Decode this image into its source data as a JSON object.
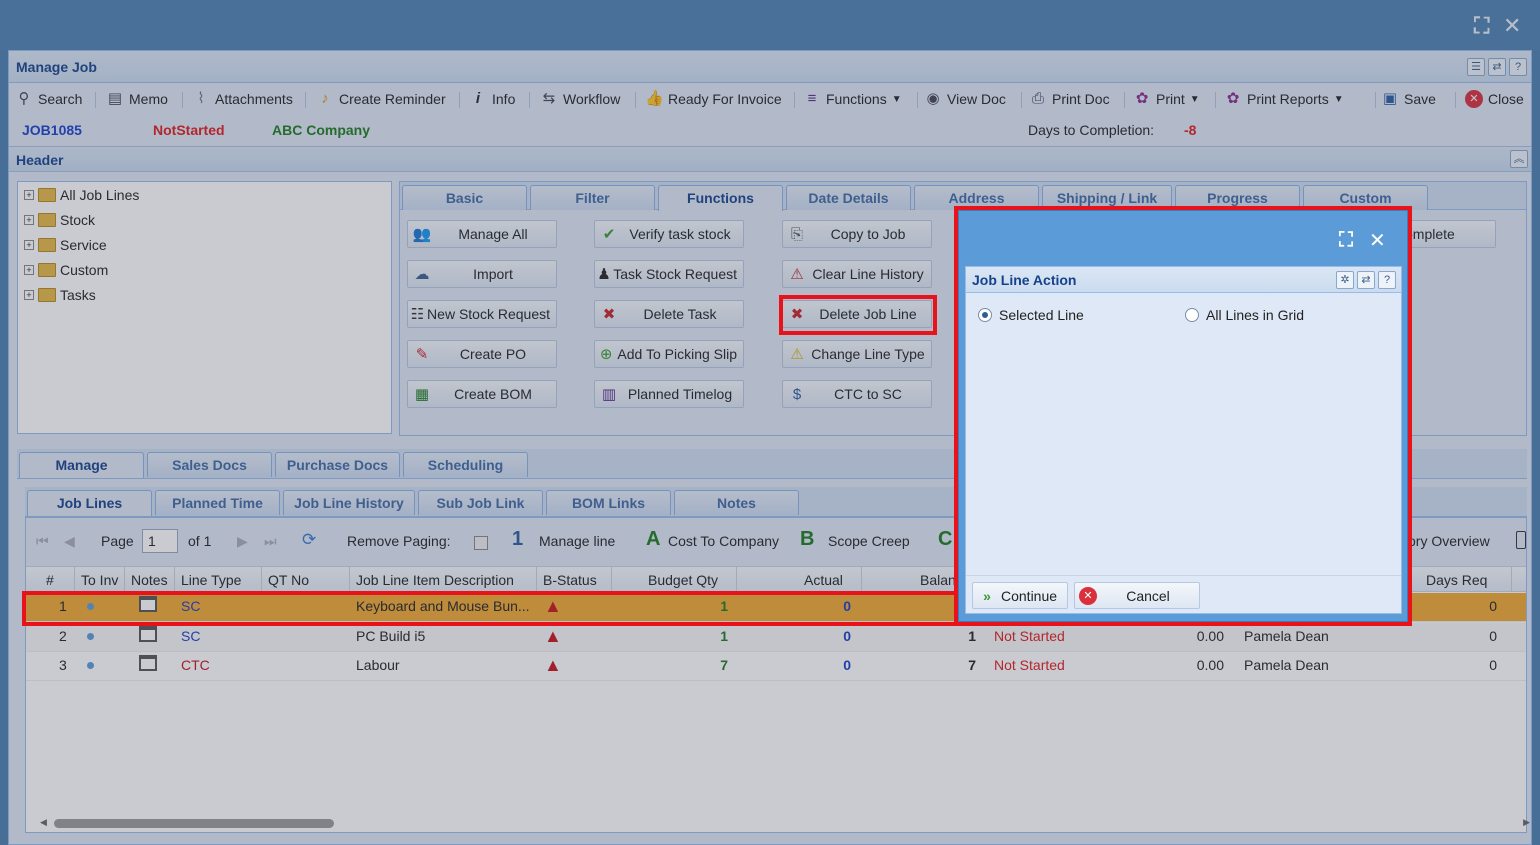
{
  "window": {
    "title": "Manage Job",
    "header_section": "Header",
    "ctrl_maximize": "⛶",
    "ctrl_close": "✕"
  },
  "toolbar": {
    "search": "Search",
    "memo": "Memo",
    "attachments": "Attachments",
    "create_reminder": "Create Reminder",
    "info": "Info",
    "workflow": "Workflow",
    "ready_for_invoice": "Ready For Invoice",
    "functions": "Functions",
    "view_doc": "View Doc",
    "print_doc": "Print Doc",
    "print": "Print",
    "print_reports": "Print Reports",
    "save": "Save",
    "close": "Close"
  },
  "job": {
    "number": "JOB1085",
    "status": "NotStarted",
    "company": "ABC Company",
    "days_label": "Days to Completion:",
    "days_value": "-8"
  },
  "tree": {
    "items": [
      "All Job Lines",
      "Stock",
      "Service",
      "Custom",
      "Tasks"
    ]
  },
  "function_tabs": [
    "Basic",
    "Filter",
    "Functions",
    "Date Details",
    "Address",
    "Shipping / Link",
    "Progress",
    "Custom"
  ],
  "function_buttons": {
    "manage_all": "Manage All",
    "import": "Import",
    "new_stock_request": "New Stock Request",
    "create_po": "Create PO",
    "create_bom": "Create BOM",
    "verify_task_stock": "Verify task stock",
    "task_stock_request": "Task Stock Request",
    "delete_task": "Delete Task",
    "add_to_picking_slip": "Add To Picking Slip",
    "planned_timelog": "Planned Timelog",
    "copy_to_job": "Copy to Job",
    "clear_line_history": "Clear Line History",
    "delete_job_line": "Delete Job Line",
    "change_line_type": "Change Line Type",
    "ctc_to_sc": "CTC to SC",
    "complete_partial": "omplete"
  },
  "bottom_tabs": [
    "Manage",
    "Sales Docs",
    "Purchase Docs",
    "Scheduling"
  ],
  "sub_tabs": [
    "Job Lines",
    "Planned Time",
    "Job Line History",
    "Sub Job Link",
    "BOM Links",
    "Notes"
  ],
  "pager": {
    "page_label": "Page",
    "page_value": "1",
    "of_label": "of 1",
    "remove_paging": "Remove Paging:",
    "legend_1_key": "1",
    "legend_1": "Manage line",
    "legend_a_key": "A",
    "legend_a": "Cost To Company",
    "legend_b_key": "B",
    "legend_b": "Scope Creep",
    "legend_c_key": "C",
    "history_overview": "ory Overview"
  },
  "grid": {
    "columns": [
      "#",
      "To Inv",
      "Notes",
      "Line Type",
      "QT No",
      "Job Line Item Description",
      "B-Status",
      "Budget Qty",
      "Actual",
      "Balanc",
      "Days Req"
    ],
    "rows": [
      {
        "num": "1",
        "type": "SC",
        "desc": "Keyboard and Mouse Bun...",
        "budget": "1",
        "actual": "0",
        "balance": "",
        "status": "",
        "cost": "",
        "assignee": "",
        "days": "0"
      },
      {
        "num": "2",
        "type": "SC",
        "desc": "PC Build i5",
        "budget": "1",
        "actual": "0",
        "balance": "1",
        "status": "Not Started",
        "cost": "0.00",
        "assignee": "Pamela Dean",
        "days": "0"
      },
      {
        "num": "3",
        "type": "CTC",
        "desc": "Labour",
        "budget": "7",
        "actual": "0",
        "balance": "7",
        "status": "Not Started",
        "cost": "0.00",
        "assignee": "Pamela Dean",
        "days": "0"
      }
    ]
  },
  "dialog": {
    "title": "Job Line Action",
    "option_selected": "Selected Line",
    "option_all": "All Lines in Grid",
    "selected_option": "Selected Line",
    "continue": "Continue",
    "cancel": "Cancel"
  },
  "colors": {
    "accent": "#15428b",
    "highlight": "#e8121b",
    "selected_row": "#f0a830",
    "job_number": "#1a3ec8",
    "status_red": "#e01b1b",
    "company_green": "#1e7a1e"
  }
}
